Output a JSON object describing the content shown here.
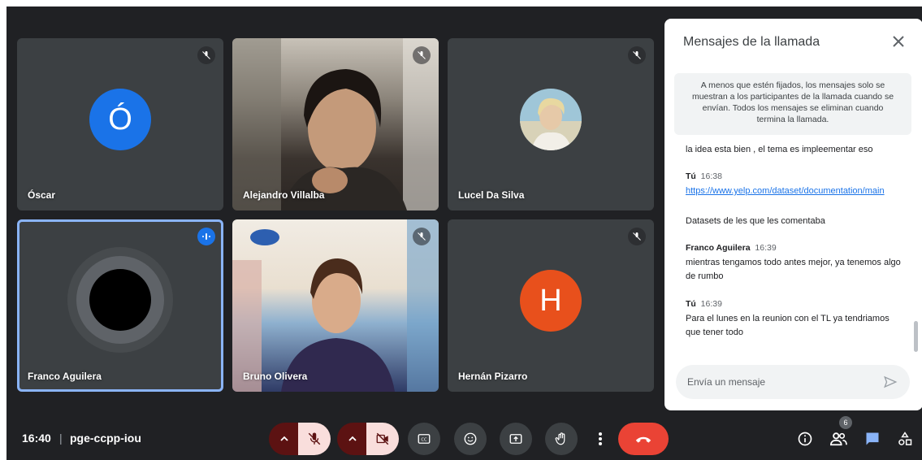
{
  "tiles": [
    {
      "name": "Óscar",
      "initial": "Ó",
      "color": "#1a73e8",
      "muted": true
    },
    {
      "name": "Alejandro Villalba",
      "muted": true
    },
    {
      "name": "Lucel Da Silva",
      "muted": true
    },
    {
      "name": "Franco Aguilera",
      "speaking": true
    },
    {
      "name": "Bruno Olivera",
      "muted": true
    },
    {
      "name": "Hernán Pizarro",
      "initial": "H",
      "color": "#e8501c",
      "muted": true
    }
  ],
  "chat": {
    "title": "Mensajes de la llamada",
    "notice": "A menos que estén fijados, los mensajes solo se muestran a los participantes de la llamada cuando se envían. Todos los mensajes se eliminan cuando termina la llamada.",
    "messages": [
      {
        "text": "la idea esta bien , el tema es impleementar eso"
      },
      {
        "sender": "Tú",
        "time": "16:38",
        "link": "https://www.yelp.com/dataset/documentation/main",
        "text": "Datasets de les que les comentaba"
      },
      {
        "sender": "Franco Aguilera",
        "time": "16:39",
        "text": "mientras tengamos todo antes mejor, ya tenemos algo de rumbo"
      },
      {
        "sender": "Tú",
        "time": "16:39",
        "text": "Para el lunes en la reunion con el TL ya tendriamos que tener todo"
      }
    ],
    "input_placeholder": "Envía un mensaje"
  },
  "bottom_bar": {
    "time": "16:40",
    "separator": "|",
    "meeting_code": "pge-ccpp-iou",
    "people_count": "6"
  },
  "colors": {
    "background": "#202124",
    "tile": "#3c4043",
    "hangup": "#ea4335",
    "accent": "#1a73e8"
  }
}
